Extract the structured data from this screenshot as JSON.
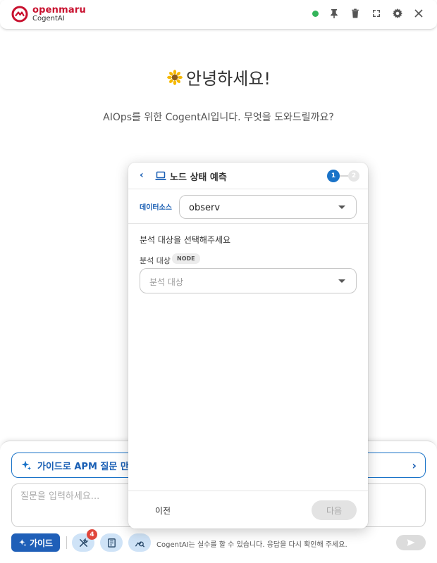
{
  "header": {
    "brand": "openmaru",
    "product": "CogentAI",
    "colors": {
      "brand": "#c8102e",
      "status": "#34b45a"
    },
    "icons": [
      "status-dot",
      "pin-icon",
      "trash-icon",
      "fullscreen-icon",
      "gear-icon",
      "close-icon"
    ]
  },
  "greeting": {
    "title": "안녕하세요!",
    "subtitle": "AIOps를 위한 CogentAI입니다. 무엇을 도와드릴까요?",
    "icon": "sunflower-icon"
  },
  "modal": {
    "title": "노드 상태 예측",
    "steps": {
      "current": "1",
      "next": "2"
    },
    "datasource_label": "데이터소스",
    "datasource_value": "observ",
    "section_title": "분석 대상을 선택해주세요",
    "target_label": "분석 대상",
    "target_tag": "NODE",
    "target_placeholder": "분석 대상",
    "prev_label": "이전",
    "next_label": "다음"
  },
  "bottom": {
    "guide_banner": "가이드로 APM 질문 만들",
    "input_placeholder": "질문을 입력하세요...",
    "guide_button": "가이드",
    "tools_badge": "4",
    "disclaimer": "CogentAI는 실수를 할 수 있습니다. 응답을 다시 확인해 주세요.",
    "colors": {
      "accent": "#1f5fb8",
      "tool_bg": "#cfe3f7",
      "badge": "#e0473c"
    }
  }
}
